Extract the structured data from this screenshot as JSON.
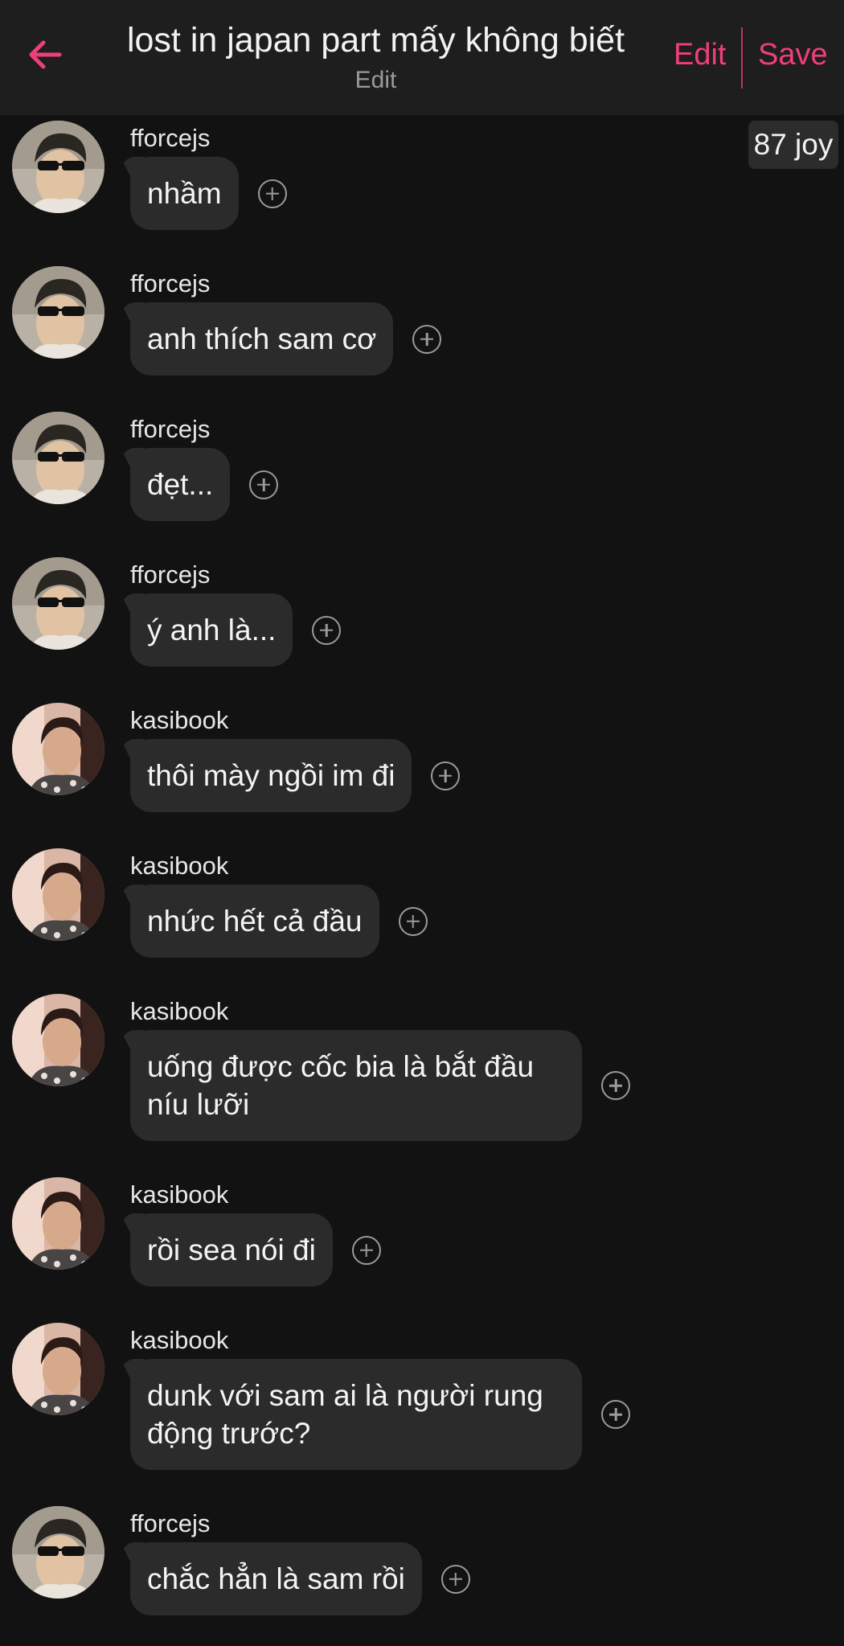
{
  "header": {
    "title": "lost in japan part mấy không biết",
    "subtitle": "Edit",
    "edit_label": "Edit",
    "save_label": "Save",
    "back_icon": "arrow-left-icon"
  },
  "reaction_badge": "87 joy",
  "colors": {
    "accent": "#ef3f78",
    "background": "#121212",
    "header_bg": "#1e1e1e",
    "bubble_bg": "#2b2b2b"
  },
  "messages": [
    {
      "user": "fforcejs",
      "avatar": "avatar-fforcejs",
      "text": "nhầm"
    },
    {
      "user": "fforcejs",
      "avatar": "avatar-fforcejs",
      "text": "anh thích sam cơ"
    },
    {
      "user": "fforcejs",
      "avatar": "avatar-fforcejs",
      "text": "đẹt..."
    },
    {
      "user": "fforcejs",
      "avatar": "avatar-fforcejs",
      "text": "ý anh là..."
    },
    {
      "user": "kasibook",
      "avatar": "avatar-kasibook",
      "text": "thôi mày ngồi im đi"
    },
    {
      "user": "kasibook",
      "avatar": "avatar-kasibook",
      "text": "nhức hết cả đầu"
    },
    {
      "user": "kasibook",
      "avatar": "avatar-kasibook",
      "text": "uống được cốc bia là bắt đầu níu lưỡi"
    },
    {
      "user": "kasibook",
      "avatar": "avatar-kasibook",
      "text": "rồi sea nói đi"
    },
    {
      "user": "kasibook",
      "avatar": "avatar-kasibook",
      "text": "dunk với sam ai là người rung động trước?"
    },
    {
      "user": "fforcejs",
      "avatar": "avatar-fforcejs",
      "text": "chắc hẳn là sam rồi"
    }
  ]
}
